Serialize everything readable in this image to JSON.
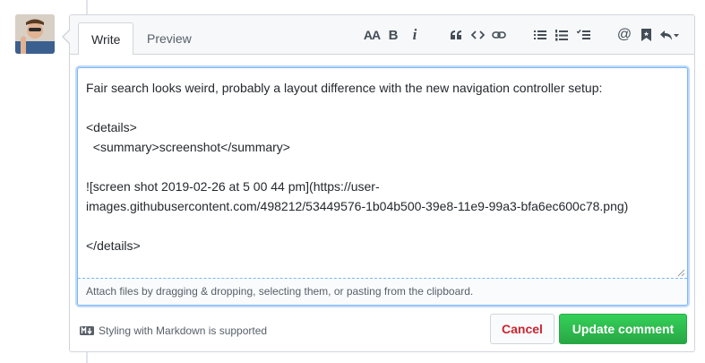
{
  "tabs": {
    "write": "Write",
    "preview": "Preview"
  },
  "toolbar": {
    "heading": "AA",
    "bold": "B",
    "italic": "i",
    "mention": "@"
  },
  "editor": {
    "text": "Fair search looks weird, probably a layout difference with the new navigation controller setup:\n\n<details>\n  <summary>screenshot</summary>\n\n![screen shot 2019-02-26 at 5 00 44 pm](https://user-\nimages.githubusercontent.com/498212/53449576-1b04b500-39e8-11e9-99a3-bfa6ec600c78.png)\n\n</details>",
    "attach_hint": "Attach files by dragging & dropping, selecting them, or pasting from the clipboard."
  },
  "footer": {
    "markdown_note": "Styling with Markdown is supported",
    "cancel_label": "Cancel",
    "update_label": "Update comment"
  },
  "colors": {
    "accent_blue": "#79b8ff",
    "cancel_red": "#cb2431",
    "update_green": "#2ea44f"
  }
}
